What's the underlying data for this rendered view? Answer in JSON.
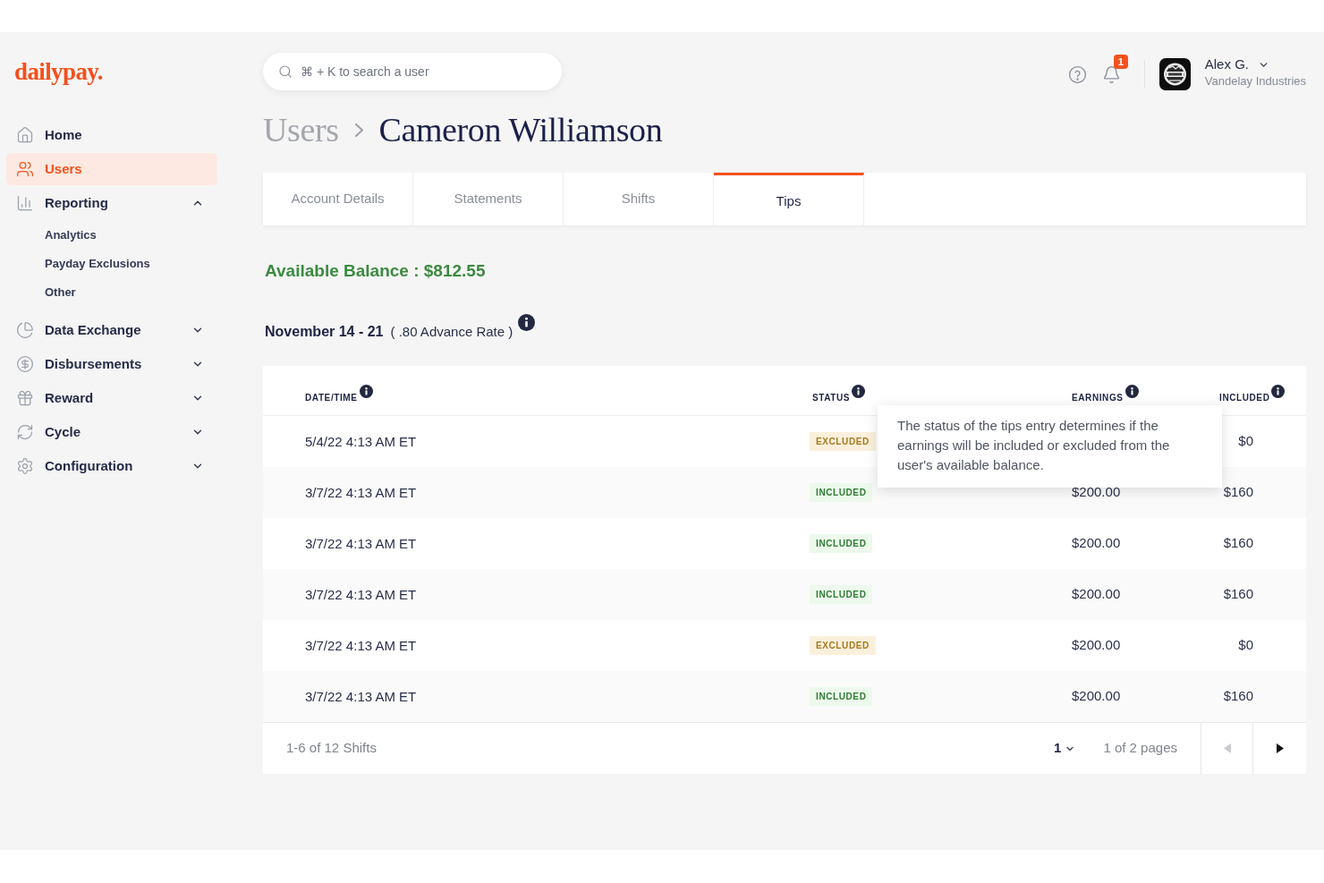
{
  "sidebar": {
    "logo": "dailypay.",
    "items": [
      {
        "kind": "link",
        "label": "Home",
        "selected": false
      },
      {
        "kind": "link",
        "label": "Users",
        "selected": true
      },
      {
        "kind": "group",
        "label": "Reporting",
        "selected": false,
        "expanded": true,
        "children": [
          {
            "label": "Analytics",
            "selected": false
          },
          {
            "label": "Payday Exclusions",
            "selected": false
          },
          {
            "label": "Other",
            "selected": false
          }
        ]
      },
      {
        "kind": "group",
        "label": "Data Exchange",
        "selected": false,
        "expanded": false
      },
      {
        "kind": "group",
        "label": "Disbursements",
        "selected": false,
        "expanded": false
      },
      {
        "kind": "group",
        "label": "Reward",
        "selected": false,
        "expanded": false
      },
      {
        "kind": "group",
        "label": "Cycle",
        "selected": false,
        "expanded": false
      },
      {
        "kind": "group",
        "label": "Configuration",
        "selected": false,
        "expanded": false
      }
    ]
  },
  "header": {
    "search": {
      "placeholder": "⌘ + K to search a user"
    },
    "notifications": {
      "count": "1"
    },
    "user": {
      "name": "Alex G.",
      "company": "Vandelay Industries"
    }
  },
  "breadcrumb": [
    {
      "label": "Users"
    },
    {
      "label": "Cameron Williamson"
    }
  ],
  "tabs": [
    {
      "label": "Account Details",
      "selected": false
    },
    {
      "label": "Statements",
      "selected": false
    },
    {
      "label": "Shifts",
      "selected": false
    },
    {
      "label": "Tips",
      "selected": true
    }
  ],
  "balance": "Available Balance : $812.55",
  "period": {
    "range": "November 14 - 21",
    "rate": "( .80 Advance Rate )"
  },
  "table": {
    "columns": [
      {
        "label": "DATE/TIME"
      },
      {
        "label": "STATUS"
      },
      {
        "label": "EARNINGS"
      },
      {
        "label": "INCLUDED"
      }
    ],
    "rows": [
      {
        "date_time": "5/4/22 4:13 AM ET",
        "status": {
          "kind": "excluded",
          "label": "EXCLUDED"
        },
        "included": "$0"
      },
      {
        "date_time": "3/7/22 4:13 AM ET",
        "status": {
          "kind": "included",
          "label": "INCLUDED"
        },
        "earnings": "$200.00",
        "included": "$160"
      },
      {
        "date_time": "3/7/22 4:13 AM ET",
        "status": {
          "kind": "included",
          "label": "INCLUDED"
        },
        "earnings": "$200.00",
        "included": "$160"
      },
      {
        "date_time": "3/7/22 4:13 AM ET",
        "status": {
          "kind": "included",
          "label": "INCLUDED"
        },
        "earnings": "$200.00",
        "included": "$160"
      },
      {
        "date_time": "3/7/22 4:13 AM ET",
        "status": {
          "kind": "excluded",
          "label": "EXCLUDED"
        },
        "earnings": "$200.00",
        "included": "$0"
      },
      {
        "date_time": "3/7/22 4:13 AM ET",
        "status": {
          "kind": "included",
          "label": "INCLUDED"
        },
        "earnings": "$200.00",
        "included": "$160"
      }
    ],
    "tooltip": "The status of the tips entry determines if the earnings will be included or excluded from the user's available balance.",
    "pagination": {
      "summary": "1-6 of 12 Shifts",
      "page_select": "1",
      "pages": "1 of 2 pages",
      "buttons": [
        {
          "kind": "prev",
          "disabled": true
        },
        {
          "kind": "next",
          "disabled": false
        }
      ]
    }
  }
}
